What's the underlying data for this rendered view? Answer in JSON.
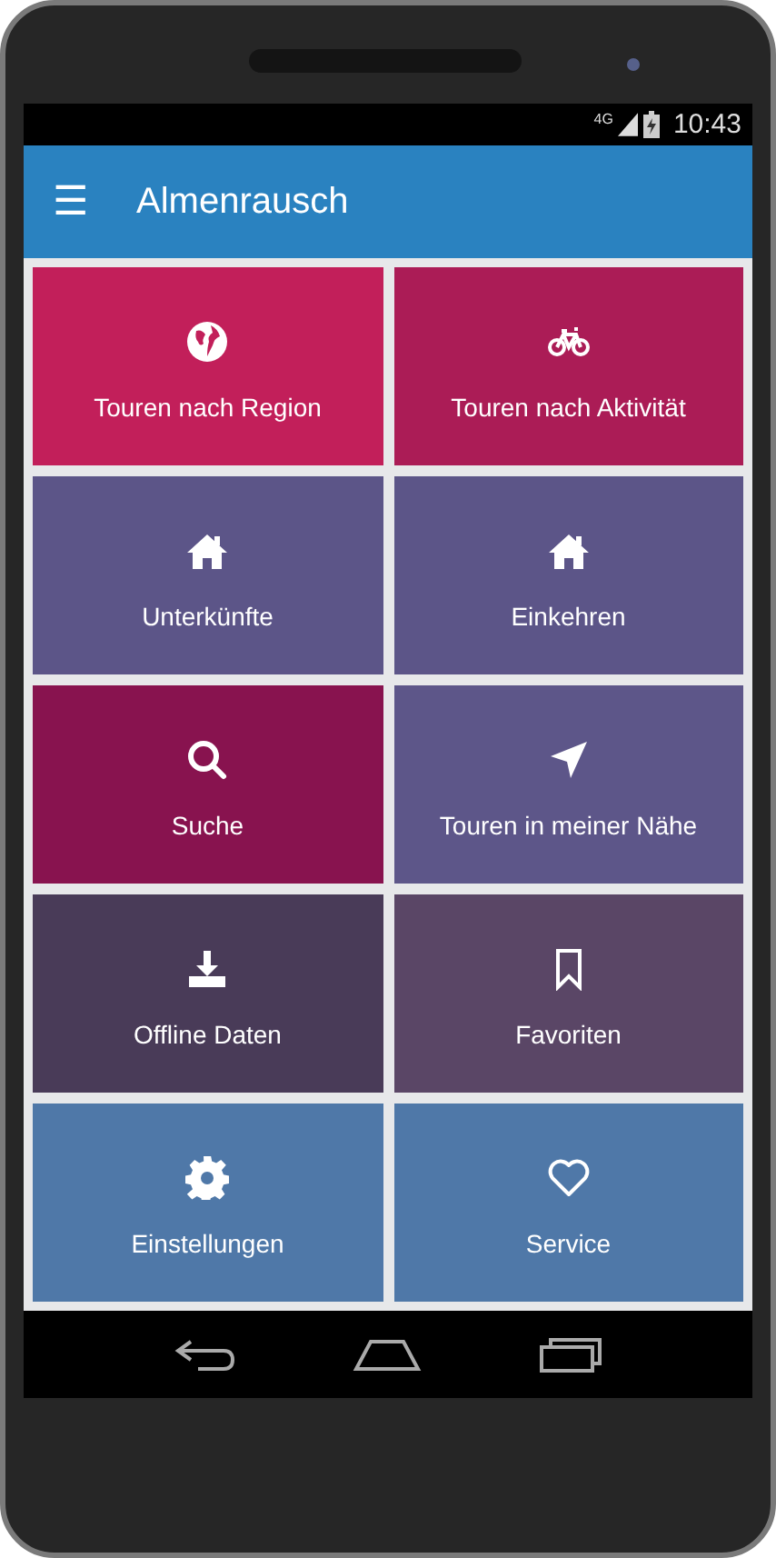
{
  "status_bar": {
    "network": "4G",
    "time": "10:43"
  },
  "app_bar": {
    "menu_icon": "☰",
    "title": "Almenrausch"
  },
  "tiles": [
    {
      "label": "Touren nach Region",
      "color": "#c21f5a"
    },
    {
      "label": "Touren nach Aktivität",
      "color": "#ab1c56"
    },
    {
      "label": "Unterkünfte",
      "color": "#5c5588"
    },
    {
      "label": "Einkehren",
      "color": "#5c5588"
    },
    {
      "label": "Suche",
      "color": "#88134f"
    },
    {
      "label": "Touren in meiner Nähe",
      "color": "#5d5689"
    },
    {
      "label": "Offline Daten",
      "color": "#493b58"
    },
    {
      "label": "Favoriten",
      "color": "#5a4666"
    },
    {
      "label": "Einstellungen",
      "color": "#4f78a8"
    },
    {
      "label": "Service",
      "color": "#4f78a8"
    }
  ]
}
